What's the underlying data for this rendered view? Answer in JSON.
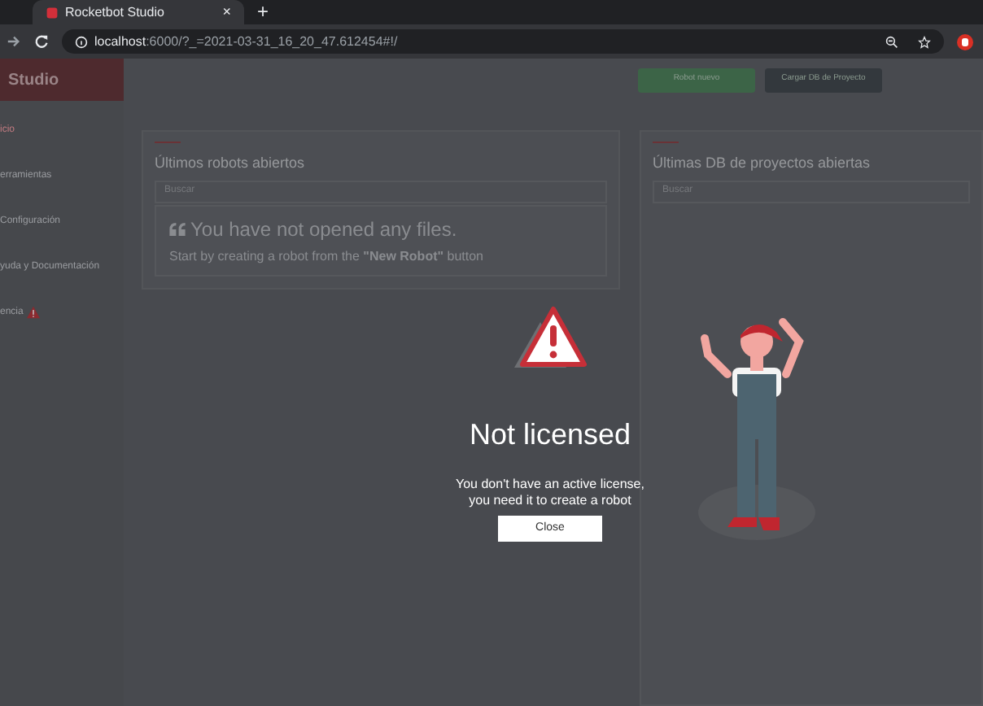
{
  "browser": {
    "tab_title": "Rocketbot Studio",
    "close_tab": "×",
    "new_tab": "+",
    "url_host": "localhost",
    "url_rest": ":6000/?_=2021-03-31_16_20_47.612454#!/"
  },
  "app": {
    "brand": "Studio",
    "sidebar": [
      {
        "label": "icio",
        "warning": false
      },
      {
        "label": "erramientas",
        "warning": false
      },
      {
        "label": "Configuración",
        "warning": false
      },
      {
        "label": "yuda y Documentación",
        "warning": false
      },
      {
        "label": "encia",
        "warning": true
      }
    ],
    "toolbar": [
      {
        "label": "Robot nuevo",
        "kind": "primary"
      },
      {
        "label": "Cargar DB de Proyecto",
        "kind": "dark"
      }
    ],
    "panels": [
      {
        "title": "Últimos robots abiertos",
        "search_placeholder": "Buscar",
        "empty": {
          "heading": "You have not opened any files.",
          "body": "Start by creating a robot from the **\"New Robot\"** button"
        }
      },
      {
        "title": "Últimas DB de proyectos abiertas",
        "search_placeholder": "Buscar"
      }
    ]
  },
  "modal": {
    "title": "Not licensed",
    "message_lines": [
      "You don't have an active license,",
      "you need it to create a robot"
    ],
    "button": "Close"
  }
}
